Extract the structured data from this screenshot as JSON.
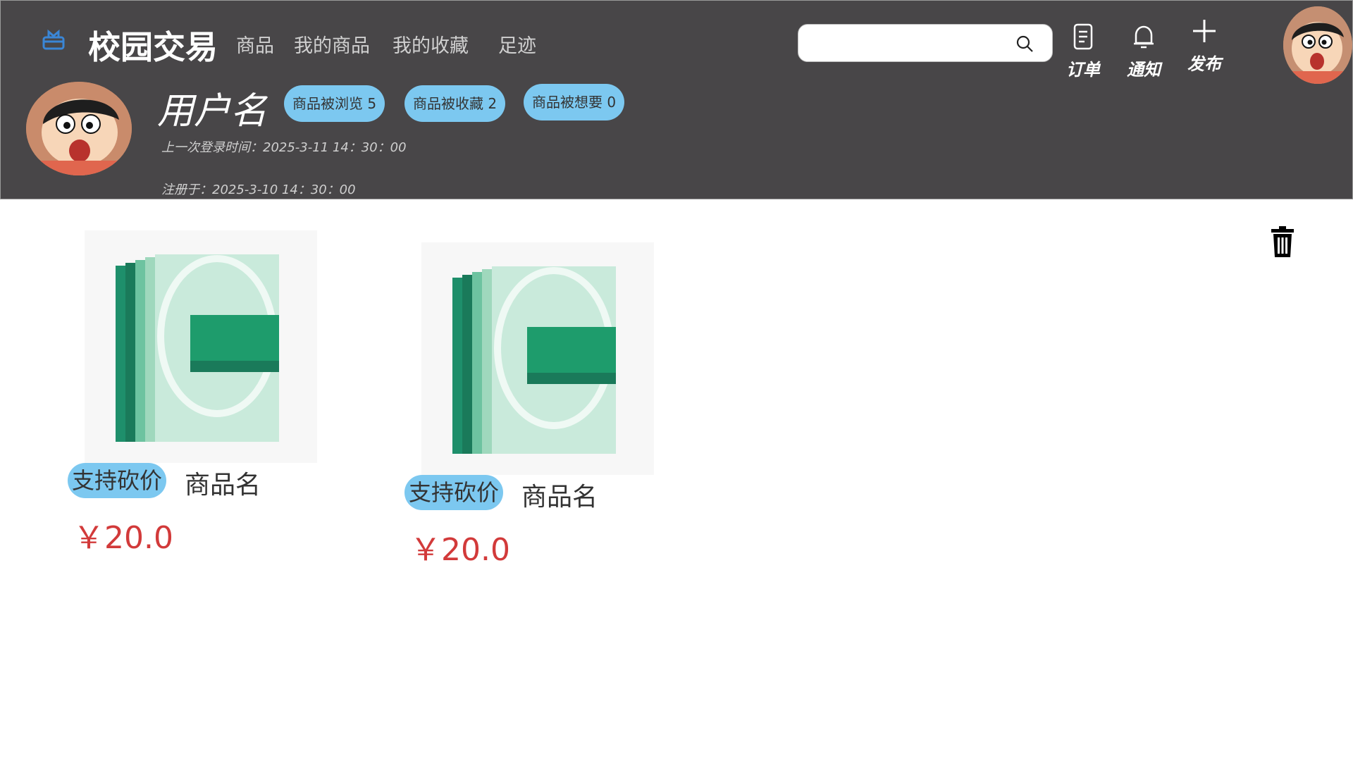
{
  "app": {
    "brand": "校园交易",
    "nav": [
      "商品",
      "我的商品",
      "我的收藏",
      "足迹"
    ],
    "search": {
      "placeholder": "",
      "value": ""
    },
    "actions": [
      {
        "label": "订单",
        "icon": "document-icon"
      },
      {
        "label": "通知",
        "icon": "bell-icon"
      },
      {
        "label": "发布",
        "icon": "plus-icon"
      }
    ]
  },
  "profile": {
    "username": "用户名",
    "stats": [
      "商品被浏览 5",
      "商品被收藏 2",
      "商品被想要 0"
    ],
    "last_login": "上一次登录时间：2025-3-11  14：30：00",
    "registered": "注册于：2025-3-10 14：30：00"
  },
  "items": [
    {
      "tag": "支持砍价",
      "name": "商品名",
      "price": "￥20.0",
      "image": "book-set-cover"
    },
    {
      "tag": "支持砍价",
      "name": "商品名",
      "price": "￥20.0",
      "image": "book-set-cover"
    }
  ],
  "colors": {
    "header_bg": "#484648",
    "tag_bg": "#7cc8f0",
    "price": "#d23a3a",
    "brand_icon": "#3a86d6"
  }
}
